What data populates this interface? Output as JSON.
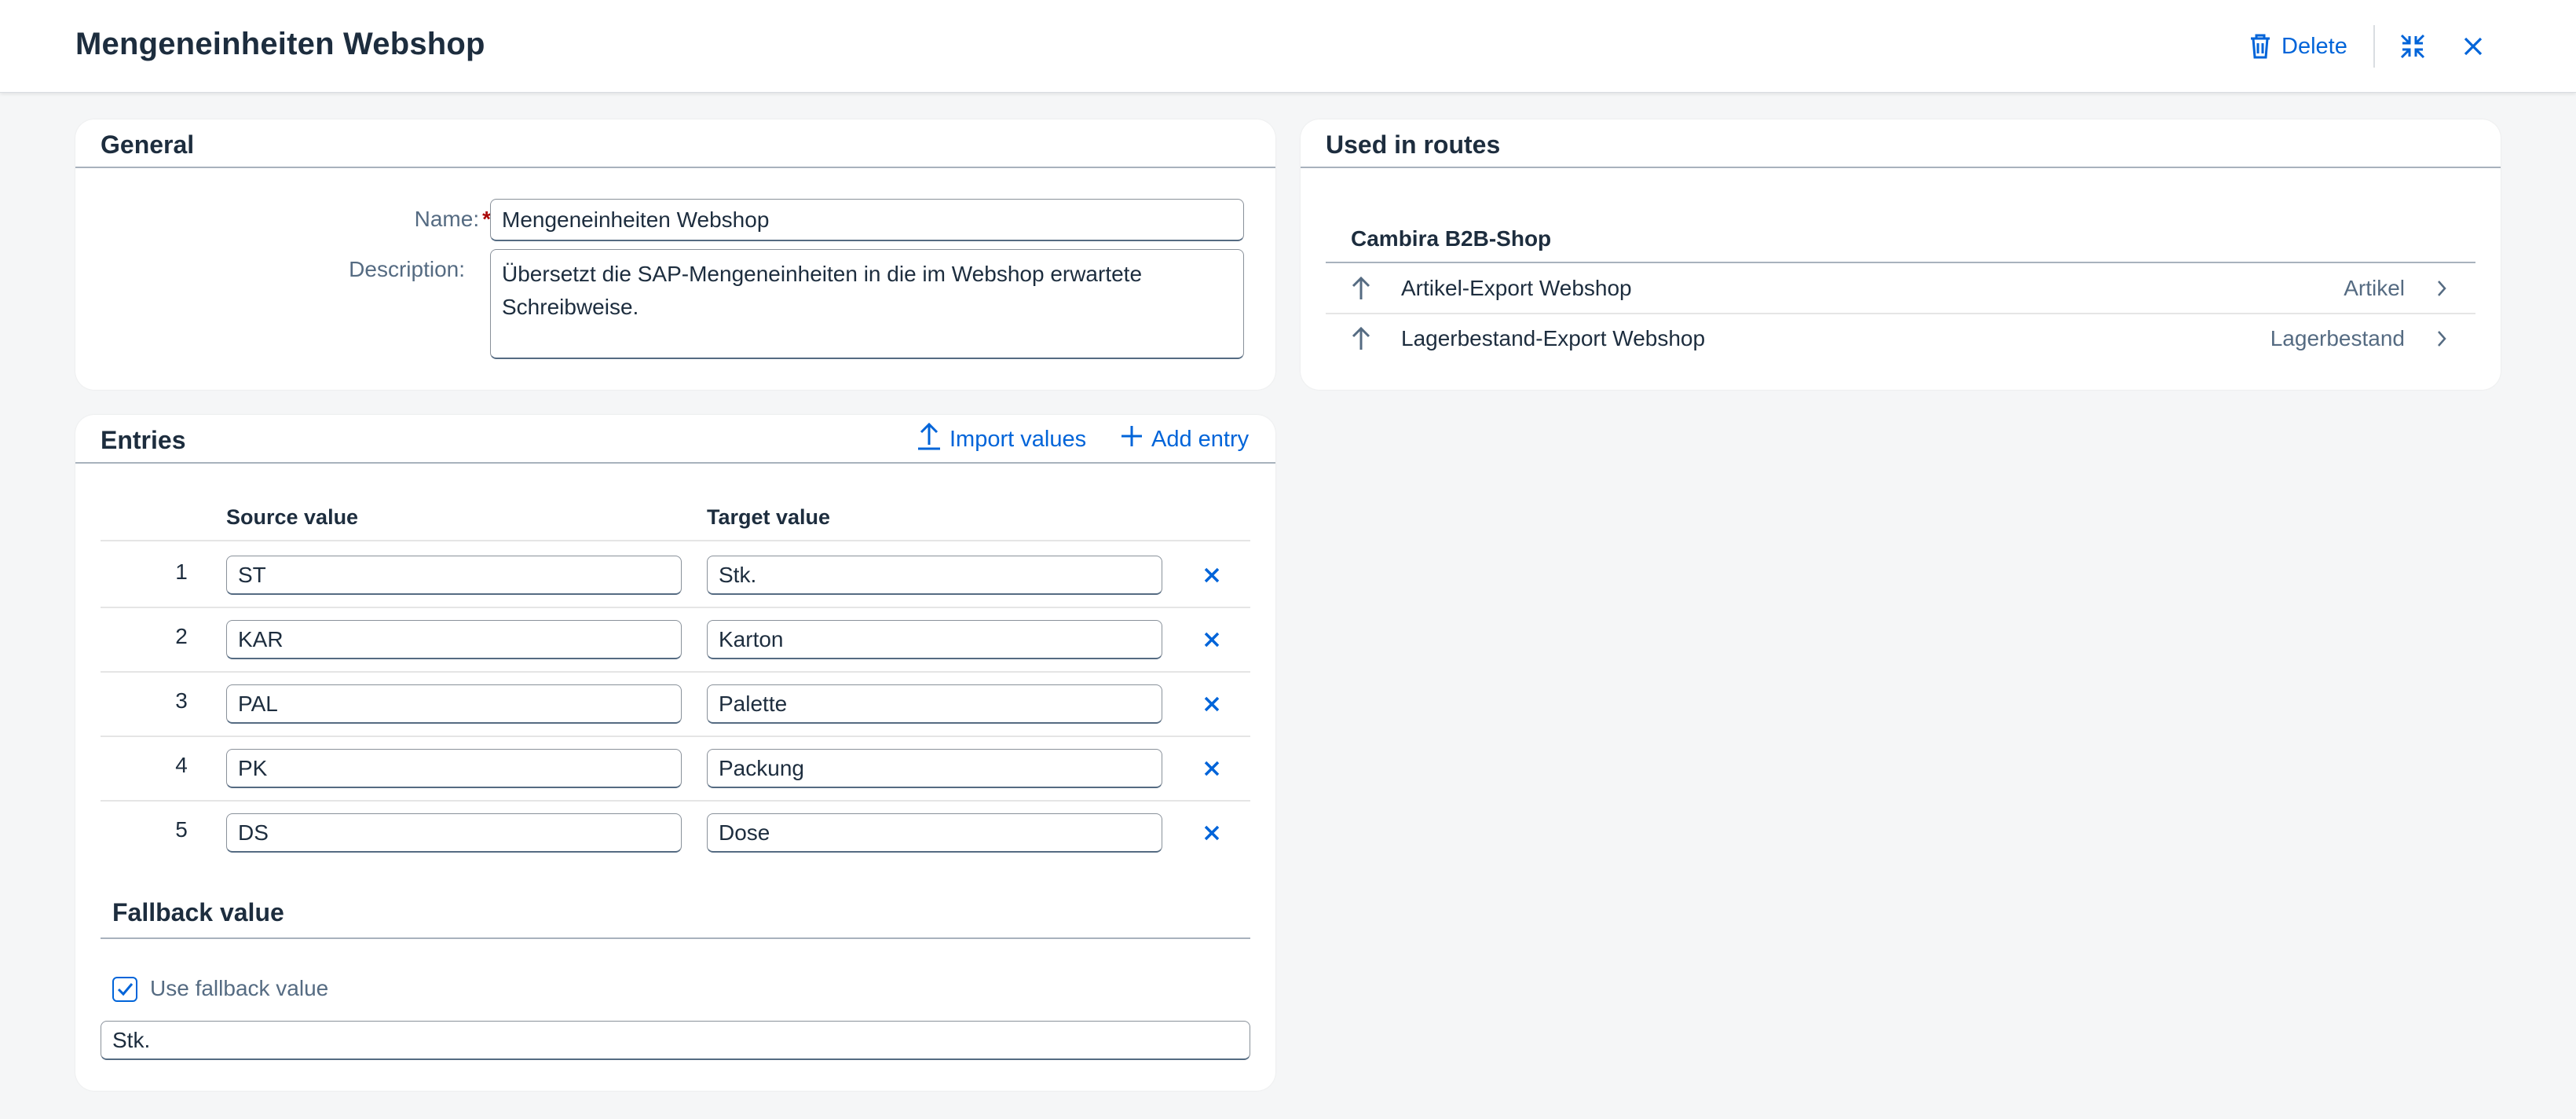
{
  "header": {
    "title": "Mengeneinheiten Webshop",
    "delete_label": "Delete",
    "icons": {
      "delete": "trash-icon",
      "exit_fullscreen": "exit-fullscreen-icon",
      "close": "close-icon"
    }
  },
  "general": {
    "title": "General",
    "name_label": "Name:",
    "required_marker": "*",
    "name_value": "Mengeneinheiten Webshop",
    "description_label": "Description:",
    "description_value": "Übersetzt die SAP-Mengeneinheiten in die im Webshop erwartete Schreibweise."
  },
  "entries": {
    "title": "Entries",
    "import_label": "Import values",
    "add_label": "Add entry",
    "columns": {
      "source": "Source value",
      "target": "Target value"
    },
    "rows": [
      {
        "num": "1",
        "source": "ST",
        "target": "Stk."
      },
      {
        "num": "2",
        "source": "KAR",
        "target": "Karton"
      },
      {
        "num": "3",
        "source": "PAL",
        "target": "Palette"
      },
      {
        "num": "4",
        "source": "PK",
        "target": "Packung"
      },
      {
        "num": "5",
        "source": "DS",
        "target": "Dose"
      }
    ],
    "fallback": {
      "title": "Fallback value",
      "checkbox_label": "Use fallback value",
      "checked": true,
      "value": "Stk."
    }
  },
  "routes": {
    "title": "Used in routes",
    "group": "Cambira B2B-Shop",
    "items": [
      {
        "name": "Artikel-Export Webshop",
        "type": "Artikel"
      },
      {
        "name": "Lagerbestand-Export Webshop",
        "type": "Lagerbestand"
      }
    ]
  },
  "colors": {
    "accent": "#0064d9",
    "text": "#1d2d3e",
    "muted": "#556b82",
    "required": "#aa0808",
    "background": "#f5f6f7"
  }
}
